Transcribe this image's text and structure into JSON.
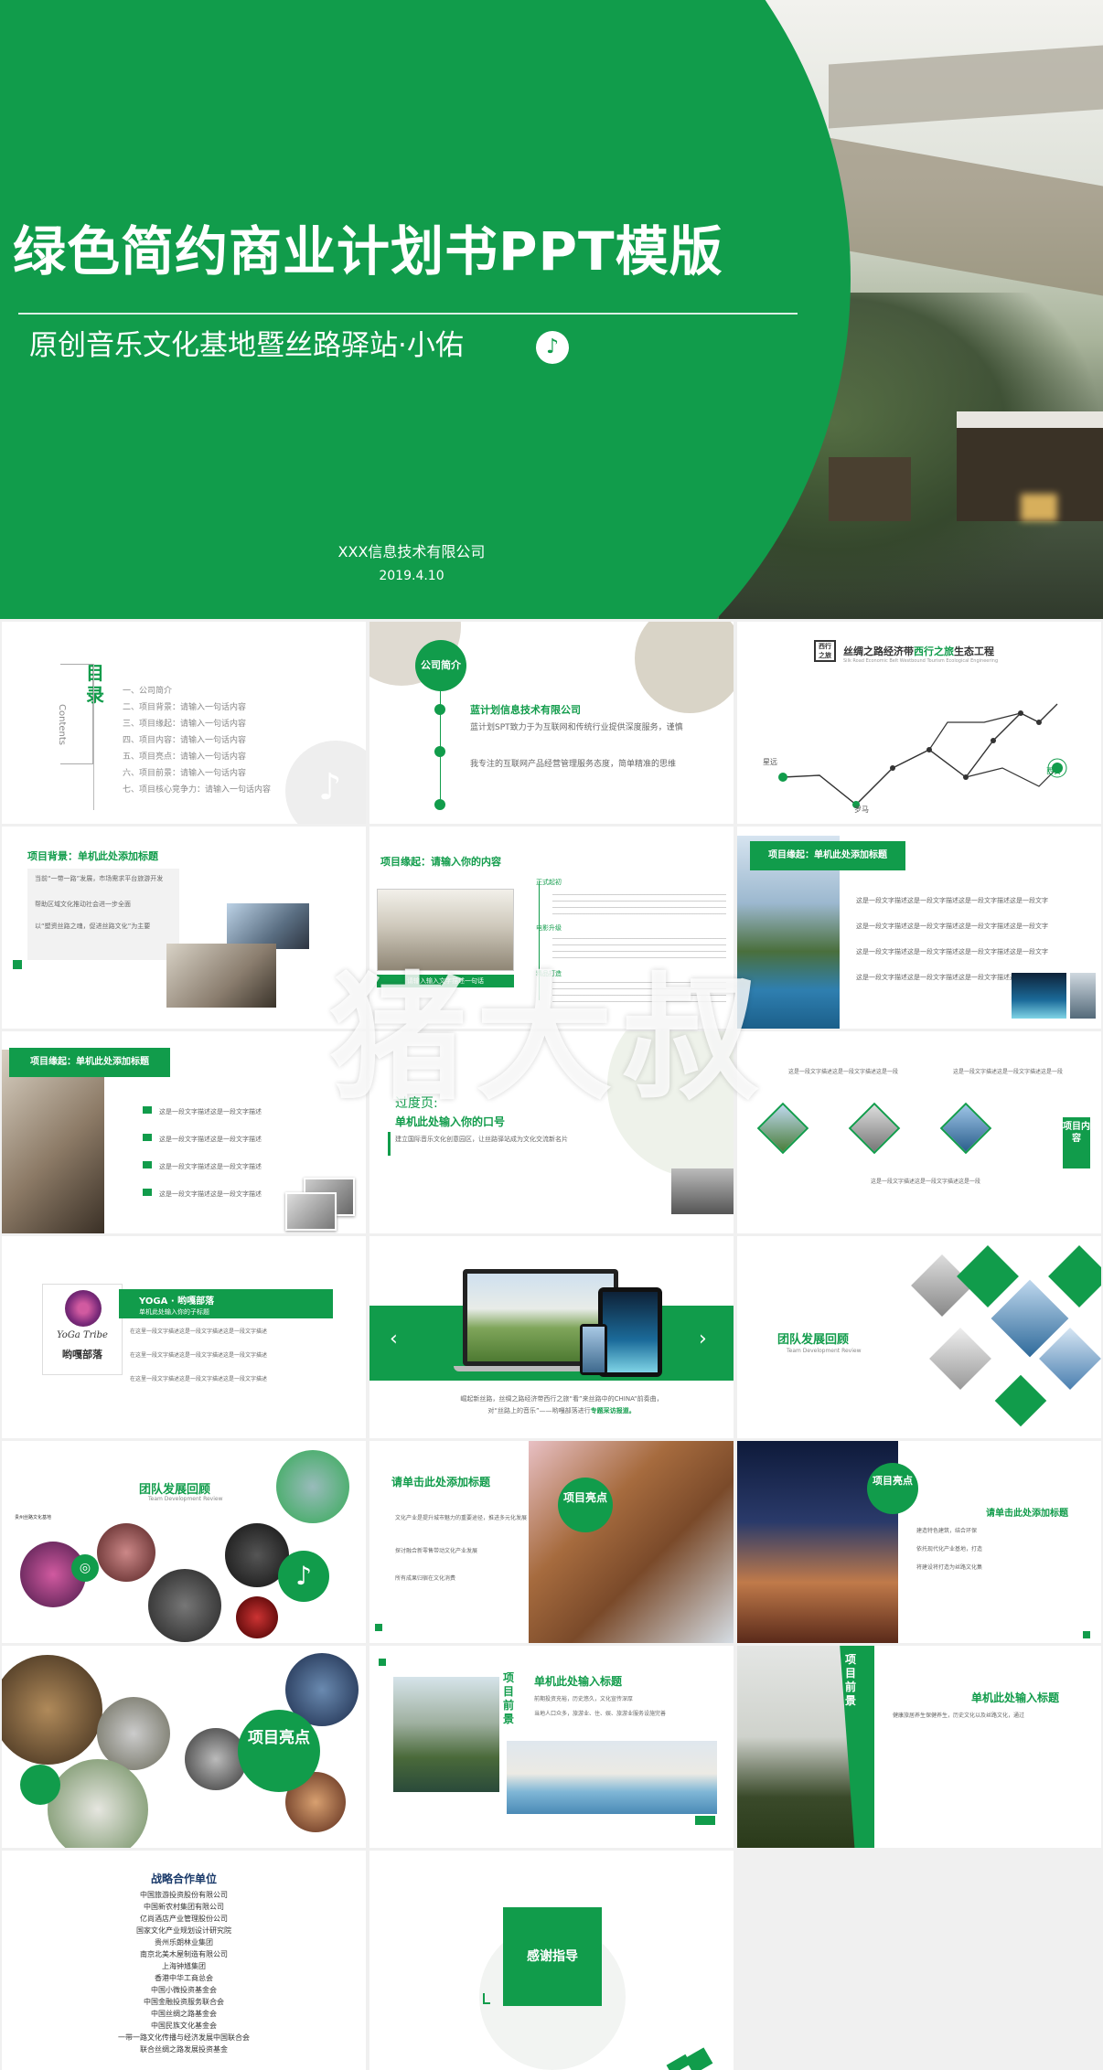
{
  "hero": {
    "title": "绿色简约商业计划书PPT模版",
    "subtitle": "原创音乐文化基地暨丝路驿站·小佑",
    "note_icon": "music-note-icon",
    "company": "XXX信息技术有限公司",
    "date": "2019.4.10"
  },
  "colors": {
    "accent": "#119c4b",
    "background": "#f0f0f0"
  },
  "watermark": "猪大叔",
  "s1": {
    "title": "目录",
    "title_en": "Contents",
    "items": [
      "一、公司简介",
      "二、项目背景：请输入一句话内容",
      "三、项目缘起：请输入一句话内容",
      "四、项目内容：请输入一句话内容",
      "五、项目亮点：请输入一句话内容",
      "六、项目前景：请输入一句话内容",
      "七、项目核心竞争力：请输入一句话内容"
    ]
  },
  "s2": {
    "badge": "公司简介",
    "company": "蓝计划信息技术有限公司",
    "p1": "蓝计划SPT致力于为互联网和传统行业提供深度服务，谨慎",
    "p2": "我专注的互联网产品经营管理服务态度，简单精准的思维"
  },
  "s3": {
    "logo": "西行之旅",
    "title_prefix": "丝绸之路经济带",
    "title_accent": "西行之旅",
    "title_suffix": "生态工程",
    "subtitle": "Silk Road Economic Belt Westbound Tourism Ecological Engineering",
    "places": [
      "星远",
      "罗马",
      "西安"
    ]
  },
  "s4": {
    "title": "项目背景：单机此处添加标题",
    "bullets": [
      "当前“一带一路”发展，市场需求平台旅游开发",
      "帮助区域文化推动社会进一步全面",
      "以“塑资丝路之魂，促进丝路文化”为主要"
    ]
  },
  "s5": {
    "title": "项目缘起：请输入你的内容",
    "labels": [
      "正式起初",
      "电影升级",
      "精品打造"
    ],
    "caption": "请输入输入文字描述一句话"
  },
  "s6": {
    "title": "项目缘起：单机此处添加标题",
    "lines": [
      "这是一段文字描述这是一段文字描述这是一段文字描述这是一段文字",
      "这是一段文字描述这是一段文字描述这是一段文字描述这是一段文字",
      "这是一段文字描述这是一段文字描述这是一段文字描述这是一段文字",
      "这是一段文字描述这是一段文字描述这是一段文字描述这是一段文字"
    ]
  },
  "s7": {
    "title": "项目缘起：单机此处添加标题",
    "rows": [
      "这是一段文字描述这是一段文字描述",
      "这是一段文字描述这是一段文字描述",
      "这是一段文字描述这是一段文字描述",
      "这是一段文字描述这是一段文字描述"
    ]
  },
  "s8": {
    "kicker": "过度页:",
    "title": "单机此处输入你的口号",
    "body": "建立国际音乐文化创意园区，让丝路驿站成为文化交流新名片"
  },
  "s9": {
    "side_title": "项目内容",
    "notes": [
      "这是一段文字描述这是一段文字描述这是一段",
      "这是一段文字描述这是一段文字描述这是一段",
      "这是一段文字描述这是一段文字描述这是一段"
    ]
  },
  "s10": {
    "logo_text": "YoGa Tribe",
    "logo_cn": "哟嘎部落",
    "title": "YOGA · 哟嘎部落",
    "subtitle": "单机此处输入你的子标题",
    "body": [
      "在这里一段文字描述这是一段文字描述这是一段文字描述",
      "在这里一段文字描述这是一段文字描述这是一段文字描述",
      "在这里一段文字描述这是一段文字描述这是一段文字描述"
    ]
  },
  "s11": {
    "caption1": "崛起新丝路，丝绸之路经济带西行之旅“看”来丝路中的CHINA“前奏曲，",
    "caption2": "对“丝路上的音乐”——哟嘎部落进行",
    "caption_accent": "专题采访报道。"
  },
  "s12": {
    "title": "团队发展回顾",
    "subtitle": "Team Development Review"
  },
  "s13": {
    "title": "团队发展回顾",
    "subtitle": "Team Development Review",
    "logo": "贵州丝路文化基地"
  },
  "s14": {
    "title": "请单击此处添加标题",
    "bullets": [
      "文化产业是提升城市魅力的重要途径，推进多元化发展",
      "探讨融合新零售带动文化产业发展",
      "所有成果归宿在文化消费"
    ],
    "badge": "项目亮点"
  },
  "s15": {
    "badge": "项目亮点",
    "title": "请单击此处添加标题",
    "bullets": [
      "建造特色建筑，结合环保",
      "依托现代化产业基地，打造",
      "将建设将打造为丝路文化集"
    ]
  },
  "s16": {
    "badge": "项目亮点"
  },
  "s17": {
    "side": "项目前景",
    "title": "单机此处输入标题",
    "bullets": [
      "前期投资充裕，历史悠久，文化宣传深厚",
      "当地人口众多，旅游业、住、娱、旅游业服务设施完善"
    ]
  },
  "s18": {
    "side": "项目前景",
    "title": "单机此处输入标题",
    "body": "健康旅居养生保健养生，历史文化以及丝路文化，通过"
  },
  "s19": {
    "title": "战略合作单位",
    "items": [
      "中国旅游投资股份有限公司",
      "中国新农村集团有限公司",
      "亿尚酒店产业管理股份公司",
      "国家文化产业规划设计研究院",
      "贵州乐朗林业集团",
      "南京北美木屋制造有限公司",
      "上海钟馗集团",
      "香港中华工商总会",
      "中国小微投资基金会",
      "中国金融投资服务联合会",
      "中国丝绸之路基金会",
      "中国民族文化基金会",
      "一带一路文化传播与经济发展中国联合会",
      "联合丝绸之路发展投资基金"
    ]
  },
  "s20": {
    "title": "感谢指导"
  }
}
